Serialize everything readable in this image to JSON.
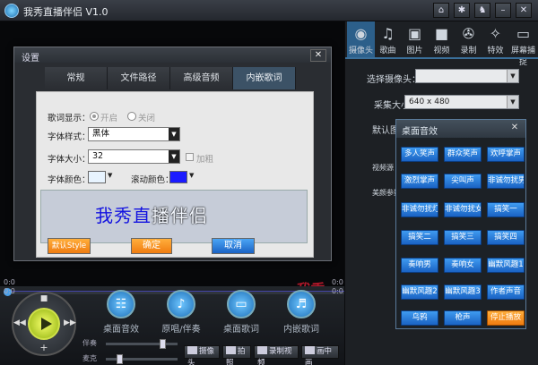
{
  "app": {
    "title": "我秀直播伴侣 V1.0"
  },
  "titlebar": {
    "buttons": [
      "home-icon",
      "gear-icon",
      "shirt-icon",
      "minimize-icon",
      "close-icon"
    ]
  },
  "right_tabs": [
    {
      "label": "摄像头",
      "icon": "camera-icon",
      "glyph": "◉"
    },
    {
      "label": "歌曲",
      "icon": "music-icon",
      "glyph": "♫"
    },
    {
      "label": "图片",
      "icon": "picture-icon",
      "glyph": "▣"
    },
    {
      "label": "视频",
      "icon": "video-icon",
      "glyph": "■"
    },
    {
      "label": "录制",
      "icon": "film-reel-icon",
      "glyph": "✇"
    },
    {
      "label": "特效",
      "icon": "magic-wand-icon",
      "glyph": "✧"
    },
    {
      "label": "屏幕捕捉",
      "icon": "screen-icon",
      "glyph": "▭"
    }
  ],
  "camera_panel": {
    "select_camera_label": "选择摄像头：",
    "select_camera_value": "",
    "capture_size_label": "采集大小：",
    "capture_size_value": "640 x 480",
    "default_label_partial": "默认图片",
    "video_label_partial": "视频源",
    "beauty_label_partial": "美颜参数"
  },
  "effects_panel": {
    "title": "桌面音效",
    "close": "✕",
    "buttons": [
      [
        "多人笑声",
        "群众笑声",
        "欢呼掌声"
      ],
      [
        "激烈掌声",
        "尖叫声",
        "非诚勿扰男"
      ],
      [
        "非诚勿扰灯",
        "非诚勿扰女",
        "搞笑一"
      ],
      [
        "搞笑二",
        "搞笑三",
        "搞笑四"
      ],
      [
        "奏响男",
        "奏响女",
        "幽默风趣1"
      ],
      [
        "幽默风趣2",
        "幽默风趣3",
        "作者声音"
      ],
      [
        "乌鸦",
        "枪声",
        "停止播放"
      ]
    ]
  },
  "dialog": {
    "title": "设置",
    "close": "✕",
    "tabs": [
      "常规",
      "文件路径",
      "高级音频",
      "内嵌歌词"
    ],
    "active_tab": "内嵌歌词",
    "lyrics_display_label": "歌词显示：",
    "radio_on_label": "开启",
    "radio_off_label": "关闭",
    "font_style_label": "字体样式：",
    "font_style_value": "黑体",
    "font_size_label": "字体大小：",
    "font_size_value": "32",
    "bold_label": "加粗",
    "font_color_label": "字体颜色：",
    "scroll_color_label": "滚动颜色：",
    "font_color": "#e8f4ff",
    "scroll_color": "#1a1aff",
    "preview_text_a": "我秀直",
    "preview_text_b": "播伴侣",
    "default_style_button": "默认Style",
    "ok_button": "确定",
    "cancel_button": "取消"
  },
  "stage": {
    "watermark": "我秀"
  },
  "bottom": {
    "time_left_top": "0:0",
    "time_right_top": "0:0",
    "time_left_bottom": "0:0",
    "time_right_bottom": "0:0",
    "features": [
      {
        "label": "桌面音效",
        "icon": "equalizer-icon",
        "glyph": "☷"
      },
      {
        "label": "原唱/伴奏",
        "icon": "microphone-icon",
        "glyph": "♪"
      },
      {
        "label": "桌面歌词",
        "icon": "monitor-icon",
        "glyph": "▭"
      },
      {
        "label": "内嵌歌词",
        "icon": "lyrics-icon",
        "glyph": "♬"
      }
    ],
    "accompaniment_label": "伴奏",
    "mic_label": "麦克",
    "shortcut_buttons": [
      "摄像头",
      "拍照",
      "录制视频",
      "画中画"
    ]
  },
  "colors": {
    "accent_blue": "#1a63c4",
    "orange": "#f07c10",
    "active_tab": "#2c5f8a"
  }
}
